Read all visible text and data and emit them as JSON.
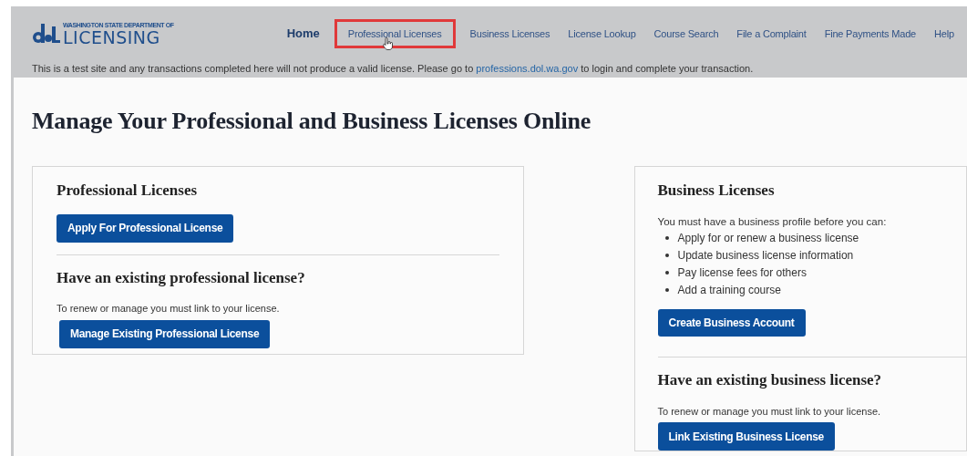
{
  "logo": {
    "line_1": "WASHINGTON STATE DEPARTMENT OF",
    "line_2": "LICENSING"
  },
  "nav": [
    {
      "label": "Home",
      "selected": false,
      "kind": "home"
    },
    {
      "label": "Professional Licenses",
      "selected": true,
      "kind": "link"
    },
    {
      "label": "Business Licenses",
      "selected": false,
      "kind": "link"
    },
    {
      "label": "License Lookup",
      "selected": false,
      "kind": "link"
    },
    {
      "label": "Course Search",
      "selected": false,
      "kind": "link"
    },
    {
      "label": "File a Complaint",
      "selected": false,
      "kind": "link"
    },
    {
      "label": "Fine Payments Made",
      "selected": false,
      "kind": "link"
    },
    {
      "label": "Help",
      "selected": false,
      "kind": "link"
    }
  ],
  "notice": {
    "before": "This is a test site and any transactions completed here will not produce a valid license. Please go to",
    "link": "professions.dol.wa.gov",
    "after": "to login and complete your transaction."
  },
  "page_title": "Manage Your Professional and Business Licenses Online",
  "professional_card": {
    "title": "Professional Licenses",
    "primary_button": "Apply For Professional License",
    "existing_title": "Have an existing professional license?",
    "existing_text": "To renew or manage you must link to your license.",
    "existing_button": "Manage Existing Professional License"
  },
  "business_card": {
    "title": "Business Licenses",
    "intro": "You must have a business profile before you can:",
    "bullets": [
      "Apply for or renew a business license",
      "Update business license information",
      "Pay license fees for others",
      "Add a training course"
    ],
    "primary_button": "Create Business Account",
    "existing_title": "Have an existing business license?",
    "existing_text": "To renew or manage you must link to your license.",
    "existing_button": "Link Existing Business License"
  }
}
